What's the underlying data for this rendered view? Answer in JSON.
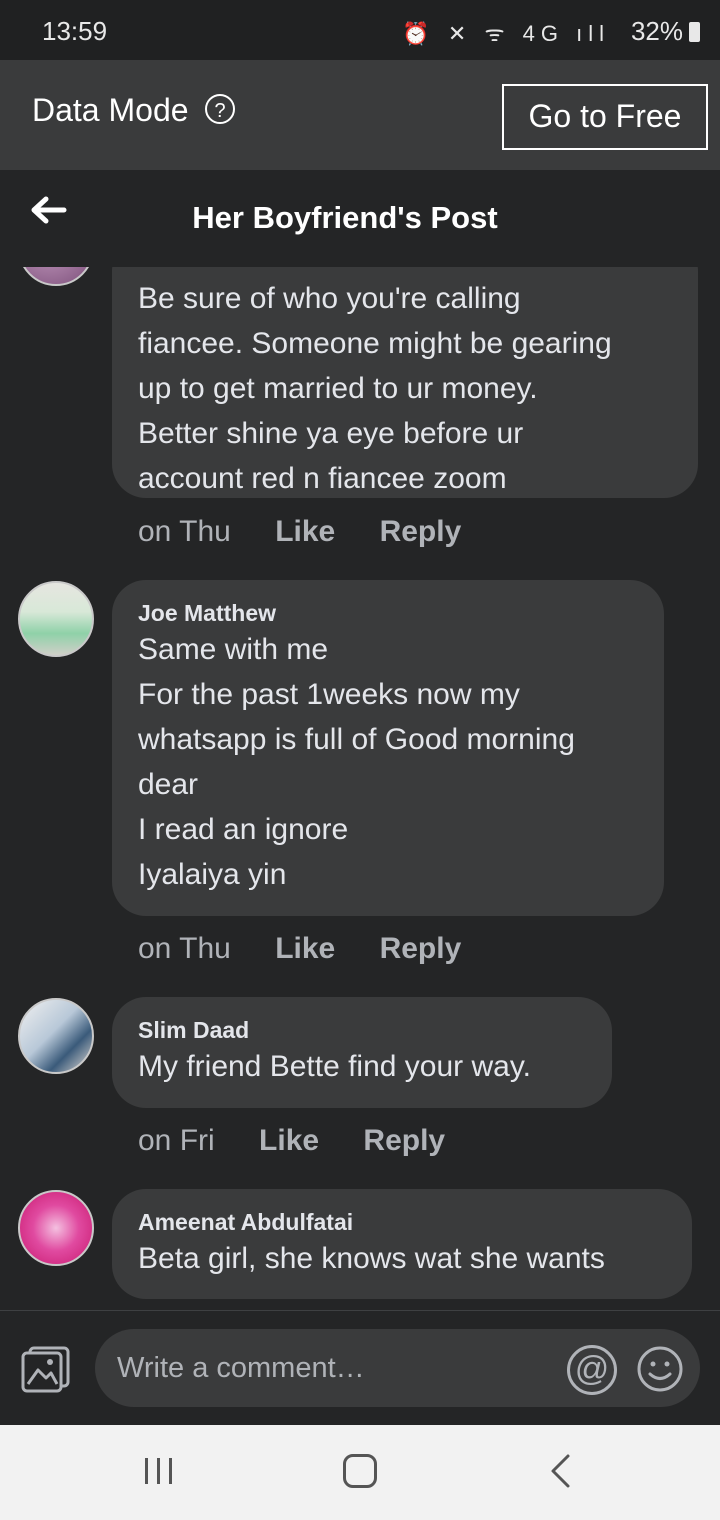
{
  "status_bar": {
    "time": "13:59",
    "battery": "32%"
  },
  "data_mode": {
    "label": "Data Mode",
    "help": "?",
    "go_free": "Go to Free"
  },
  "header": {
    "title": "Her Boyfriend's Post"
  },
  "comments": [
    {
      "author": "",
      "lines": [
        "Be sure of who you're calling",
        "fiancee. Someone might be gearing",
        "up to get married to ur money.",
        "Better shine ya eye before ur",
        "account red n fiancee zoom"
      ],
      "time": "on Thu",
      "like": "Like",
      "reply": "Reply"
    },
    {
      "author": "Joe Matthew",
      "lines": [
        "Same with me",
        "For the past 1weeks now my",
        "whatsapp is full of Good morning",
        "dear",
        "I read an ignore",
        "Iyalaiya yin"
      ],
      "time": "on Thu",
      "like": "Like",
      "reply": "Reply"
    },
    {
      "author": "Slim Daad",
      "lines": [
        "My friend Bette find your way."
      ],
      "time": "on Fri",
      "like": "Like",
      "reply": "Reply"
    },
    {
      "author": "Ameenat Abdulfatai",
      "lines": [
        "Beta girl, she knows wat she wants"
      ]
    }
  ],
  "composer": {
    "placeholder": "Write a comment…",
    "at": "@"
  },
  "icons": [
    "alarm-icon",
    "mute-icon",
    "wifi-icon",
    "4g-icon",
    "signal-icon",
    "battery-icon",
    "back-arrow-icon",
    "help-icon",
    "photo-icon",
    "at-icon",
    "emoji-icon",
    "recent-apps-icon",
    "home-icon",
    "back-icon"
  ]
}
